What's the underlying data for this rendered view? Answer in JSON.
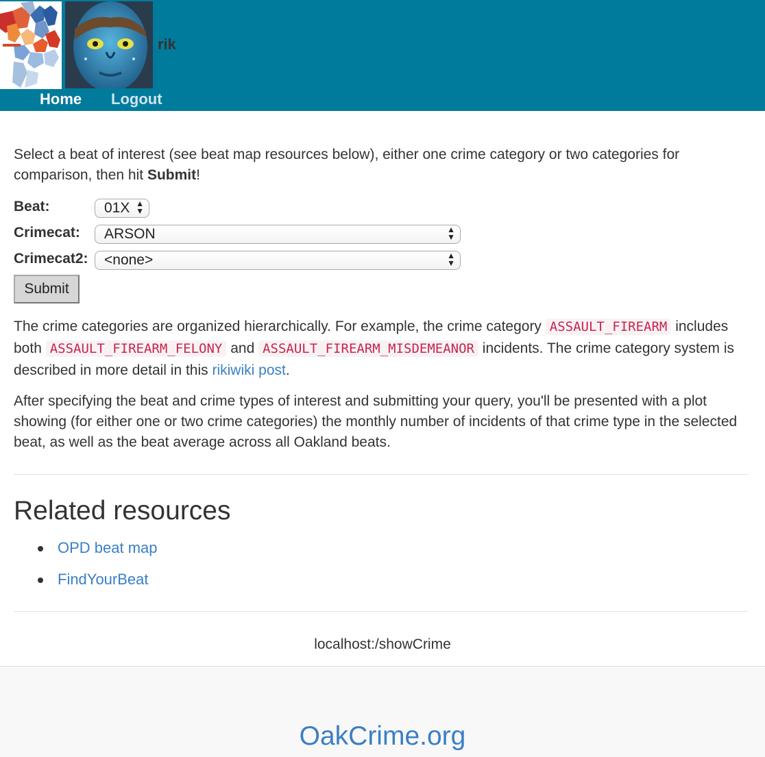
{
  "header": {
    "username": "rik",
    "nav": {
      "home": "Home",
      "logout": "Logout"
    },
    "colors": {
      "bar": "#017b9c"
    },
    "icons": {
      "map_logo": "oakland-beat-map-logo",
      "avatar": "avatar-blue-face-photo"
    }
  },
  "intro": {
    "text": "Select a beat of interest (see beat map resources below), either one crime category or two categories for comparison, then hit ",
    "bold": "Submit",
    "end": "!"
  },
  "form": {
    "beat_label": "Beat:",
    "beat_value": "01X",
    "crimecat_label": "Crimecat:",
    "crimecat_value": "ARSON",
    "crimecat2_label": "Crimecat2:",
    "crimecat2_value": "<none>",
    "submit_label": "Submit"
  },
  "hierarchy": {
    "t1": "The crime categories are organized hierarchically. For example, the crime category ",
    "code1": "ASSAULT_FIREARM",
    "t2": " includes both ",
    "code2": "ASSAULT_FIREARM_FELONY",
    "t3": " and ",
    "code3": "ASSAULT_FIREARM_MISDEMEANOR",
    "t4": " incidents. The crime category system is described in more detail in this ",
    "link": "rikiwiki post",
    "t5": "."
  },
  "after_text": "After specifying the beat and crime types of interest and submitting your query, you'll be presented with a plot showing (for either one or two crime categories) the monthly number of incidents of that crime type in the selected beat, as well as the beat average across all Oakland beats.",
  "resources": {
    "heading": "Related resources",
    "items": [
      {
        "label": "OPD beat map"
      },
      {
        "label": "FindYourBeat"
      }
    ]
  },
  "current_url": "localhost:/showCrime",
  "footer": {
    "site_name": "OakCrime.org"
  }
}
